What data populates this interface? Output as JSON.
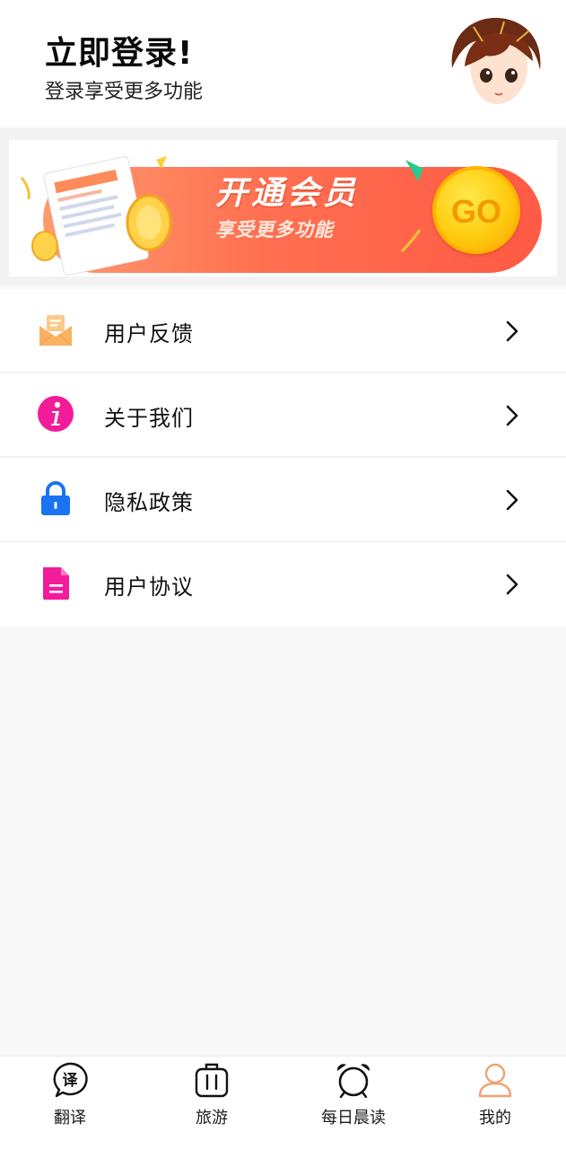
{
  "header": {
    "title": "立即登录!",
    "subtitle": "登录享受更多功能",
    "avatar_icon": "user-avatar"
  },
  "banner": {
    "title": "开通会员",
    "subtitle": "享受更多功能",
    "go_label": "GO",
    "colors": {
      "start": "#ff9a6e",
      "end": "#ff5a45",
      "go": "#ffcc10"
    }
  },
  "menu": {
    "items": [
      {
        "label": "用户反馈",
        "icon": "mail-icon",
        "color": "#f9b162"
      },
      {
        "label": "关于我们",
        "icon": "info-icon",
        "color": "#f21b9a"
      },
      {
        "label": "隐私政策",
        "icon": "lock-icon",
        "color": "#1a73f0"
      },
      {
        "label": "用户协议",
        "icon": "document-icon",
        "color": "#f21b9a"
      }
    ]
  },
  "tabbar": {
    "tabs": [
      {
        "label": "翻译",
        "icon": "translate-icon"
      },
      {
        "label": "旅游",
        "icon": "luggage-icon"
      },
      {
        "label": "每日晨读",
        "icon": "alarm-clock-icon"
      },
      {
        "label": "我的",
        "icon": "person-icon",
        "active": true,
        "active_color": "#f0a070"
      }
    ]
  }
}
